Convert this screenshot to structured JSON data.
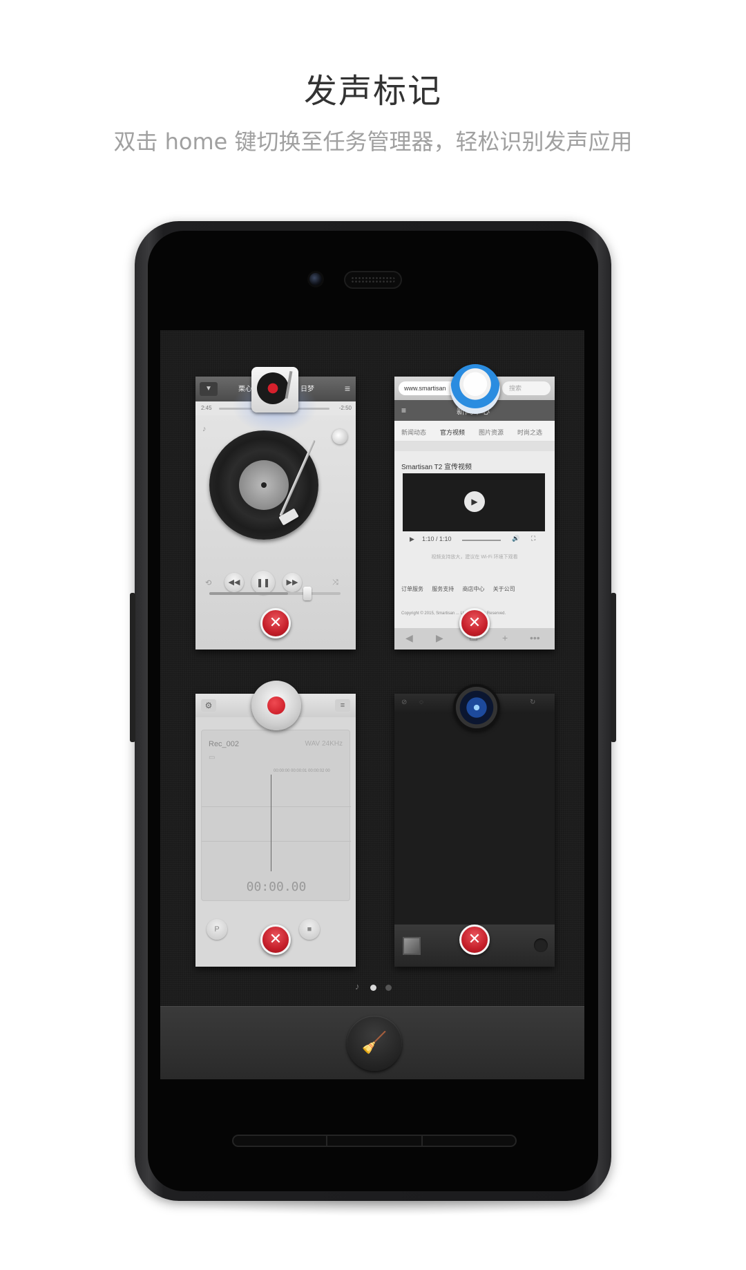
{
  "headline": "发声标记",
  "subline": "双击 home 键切换至任务管理器，轻松识别发声应用",
  "cards": {
    "music": {
      "title_left": "栗心",
      "title_right": "日梦",
      "time_elapsed": "2:45",
      "time_remaining": "-2:50",
      "close_label": "✕"
    },
    "browser": {
      "url": "www.smartisan",
      "search_placeholder": "搜索",
      "page_title": "新闻中心",
      "tabs": [
        "新闻动态",
        "官方视频",
        "图片资源",
        "时尚之选"
      ],
      "section_heading": "Smartisan T2 宣传视频",
      "video_time": "1:10 / 1:10",
      "video_note": "视频支持放大，建议在 Wi-Fi 环境下观看",
      "footer_links": "订单服务 服务支持 商店中心 关于公司",
      "copyright": "Copyright © 2015, Smartisan ... Ltd. All Rights Reserved.",
      "close_label": "✕"
    },
    "recorder": {
      "file_name": "Rec_002",
      "format": "WAV  24KHz",
      "ruler": "00:00:00  00:00:01  00:00:02  00",
      "timer": "00:00.00",
      "close_label": "✕"
    },
    "camera": {
      "close_label": "✕"
    }
  },
  "pager": {
    "note_symbol": "♪",
    "current_page": 1,
    "total_pages": 2
  },
  "clean_button_icon": "broom-icon",
  "colors": {
    "close_red": "#c51f2a",
    "record_red": "#d5202c",
    "browser_blue": "#2a8ce0"
  }
}
